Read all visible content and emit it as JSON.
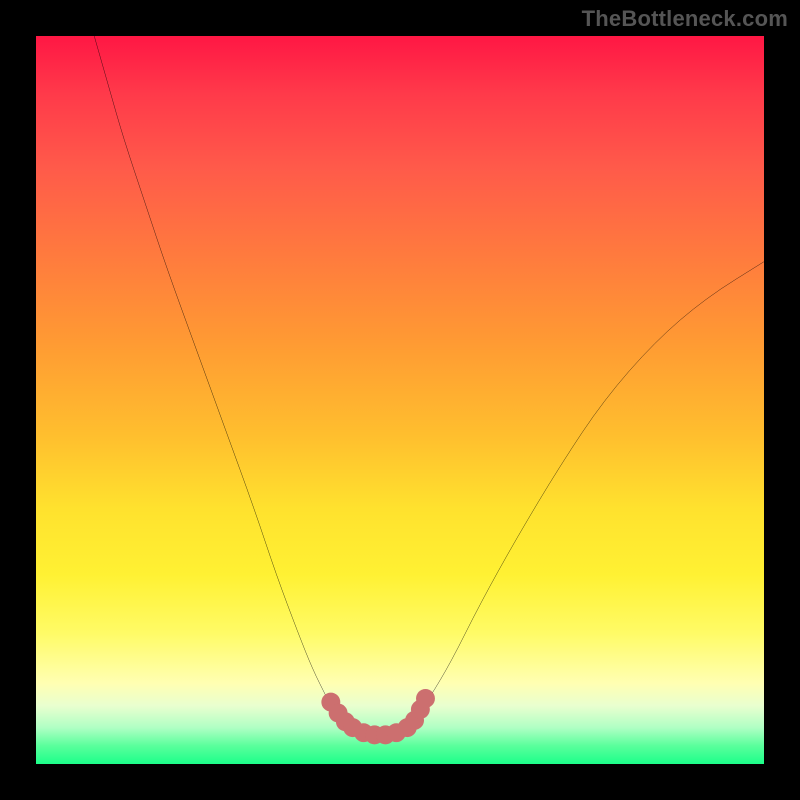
{
  "watermark": "TheBottleneck.com",
  "colors": {
    "page_bg": "#000000",
    "gradient_top": "#ff1744",
    "gradient_mid_upper": "#ff7a3e",
    "gradient_mid": "#ffe22e",
    "gradient_lower": "#ffffb3",
    "gradient_bottom": "#1cff8a",
    "curve_stroke": "#000000",
    "marker_fill": "#cc6f6f"
  },
  "chart_data": {
    "type": "line",
    "title": "",
    "xlabel": "",
    "ylabel": "",
    "xlim": [
      0,
      100
    ],
    "ylim": [
      0,
      100
    ],
    "grid": false,
    "legend": false,
    "series": [
      {
        "name": "left-branch",
        "x": [
          8,
          10,
          12,
          15,
          18,
          22,
          26,
          30,
          33,
          36,
          38,
          40,
          41,
          42
        ],
        "values": [
          100,
          93,
          86,
          77,
          68,
          57,
          46,
          35,
          26,
          18,
          13,
          9,
          7,
          6
        ]
      },
      {
        "name": "valley-floor",
        "x": [
          42,
          44,
          46,
          48,
          50,
          52
        ],
        "values": [
          6,
          4.5,
          4,
          4,
          4.5,
          6
        ]
      },
      {
        "name": "right-branch",
        "x": [
          52,
          54,
          57,
          61,
          66,
          72,
          78,
          85,
          92,
          100
        ],
        "values": [
          6,
          9,
          14,
          22,
          31,
          41,
          50,
          58,
          64,
          69
        ]
      }
    ],
    "annotations": [
      {
        "name": "marker-cluster",
        "note": "red rounded markers along valley floor between x≈40 and x≈52 near y≈4–9"
      }
    ]
  }
}
